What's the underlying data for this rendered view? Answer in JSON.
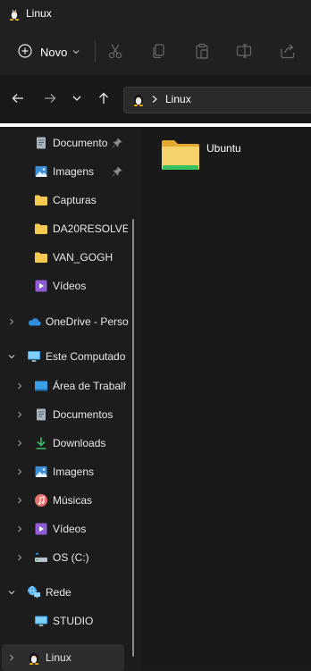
{
  "window": {
    "title": "Linux"
  },
  "toolbar": {
    "new_label": "Novo",
    "icons": [
      "cut-icon",
      "copy-icon",
      "paste-icon",
      "rename-icon",
      "share-icon"
    ]
  },
  "address": {
    "crumb": "Linux"
  },
  "sidebar": {
    "items": [
      {
        "label": "Documento",
        "icon": "documents-icon",
        "pinned": true
      },
      {
        "label": "Imagens",
        "icon": "pictures-icon",
        "pinned": true
      },
      {
        "label": "Capturas",
        "icon": "folder-icon"
      },
      {
        "label": "DA20RESOLVE",
        "icon": "folder-icon"
      },
      {
        "label": "VAN_GOGH",
        "icon": "folder-icon"
      },
      {
        "label": "Vídeos",
        "icon": "videos-icon"
      },
      {
        "label": "OneDrive - Perso",
        "icon": "onedrive-icon"
      },
      {
        "label": "Este Computado",
        "icon": "this-pc-icon"
      },
      {
        "label": "Área de Trabalh",
        "icon": "desktop-icon"
      },
      {
        "label": "Documentos",
        "icon": "documents-icon"
      },
      {
        "label": "Downloads",
        "icon": "downloads-icon"
      },
      {
        "label": "Imagens",
        "icon": "pictures-icon"
      },
      {
        "label": "Músicas",
        "icon": "music-icon"
      },
      {
        "label": "Vídeos",
        "icon": "videos-icon"
      },
      {
        "label": "OS (C:)",
        "icon": "drive-icon"
      },
      {
        "label": "Rede",
        "icon": "network-icon"
      },
      {
        "label": "STUDIO",
        "icon": "computer-icon"
      },
      {
        "label": "Linux",
        "icon": "linux-icon"
      }
    ]
  },
  "content": {
    "items": [
      {
        "name": "Ubuntu",
        "icon": "folder-icon"
      }
    ]
  },
  "colors": {
    "folder": "#f3c950",
    "accent": "#4cc2ff",
    "selected": "#2d2d2d"
  }
}
